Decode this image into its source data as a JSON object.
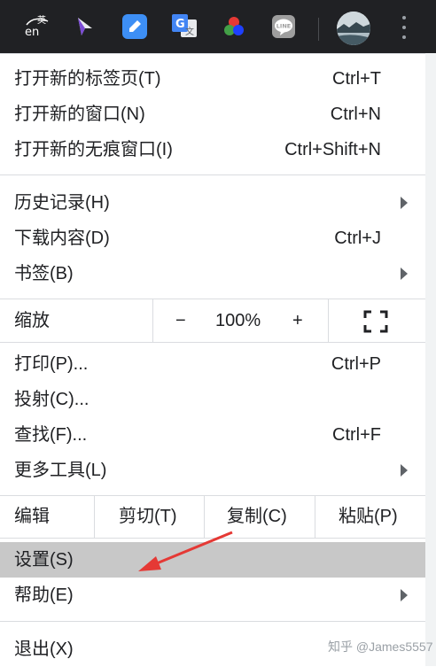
{
  "toolbar": {
    "extensions": [
      {
        "name": "translate-en-icon",
        "text_top": "英",
        "text_bottom": "en"
      },
      {
        "name": "cursor-icon"
      },
      {
        "name": "edit-extension-icon"
      },
      {
        "name": "google-translate-icon",
        "text_left": "G",
        "text_right": "文"
      },
      {
        "name": "rgb-circles-icon"
      },
      {
        "name": "line-icon",
        "text": "LINE"
      }
    ],
    "avatar_icon": "profile-avatar",
    "menu_icon": "kebab-menu-icon"
  },
  "menu": {
    "new_tab": {
      "label": "打开新的标签页(T)",
      "shortcut": "Ctrl+T"
    },
    "new_window": {
      "label": "打开新的窗口(N)",
      "shortcut": "Ctrl+N"
    },
    "new_incognito": {
      "label": "打开新的无痕窗口(I)",
      "shortcut": "Ctrl+Shift+N"
    },
    "history": {
      "label": "历史记录(H)"
    },
    "downloads": {
      "label": "下载内容(D)",
      "shortcut": "Ctrl+J"
    },
    "bookmarks": {
      "label": "书签(B)"
    },
    "zoom": {
      "label": "缩放",
      "minus": "−",
      "value": "100%",
      "plus": "+"
    },
    "print": {
      "label": "打印(P)...",
      "shortcut": "Ctrl+P"
    },
    "cast": {
      "label": "投射(C)..."
    },
    "find": {
      "label": "查找(F)...",
      "shortcut": "Ctrl+F"
    },
    "more_tools": {
      "label": "更多工具(L)"
    },
    "edit": {
      "label": "编辑",
      "cut": "剪切(T)",
      "copy": "复制(C)",
      "paste": "粘贴(P)"
    },
    "settings": {
      "label": "设置(S)"
    },
    "help": {
      "label": "帮助(E)"
    },
    "exit": {
      "label": "退出(X)"
    }
  },
  "watermark": "知乎 @James5557",
  "colors": {
    "toolbar": "#202124",
    "highlight": "#c8c8c8",
    "annotation_arrow": "#e53935"
  }
}
